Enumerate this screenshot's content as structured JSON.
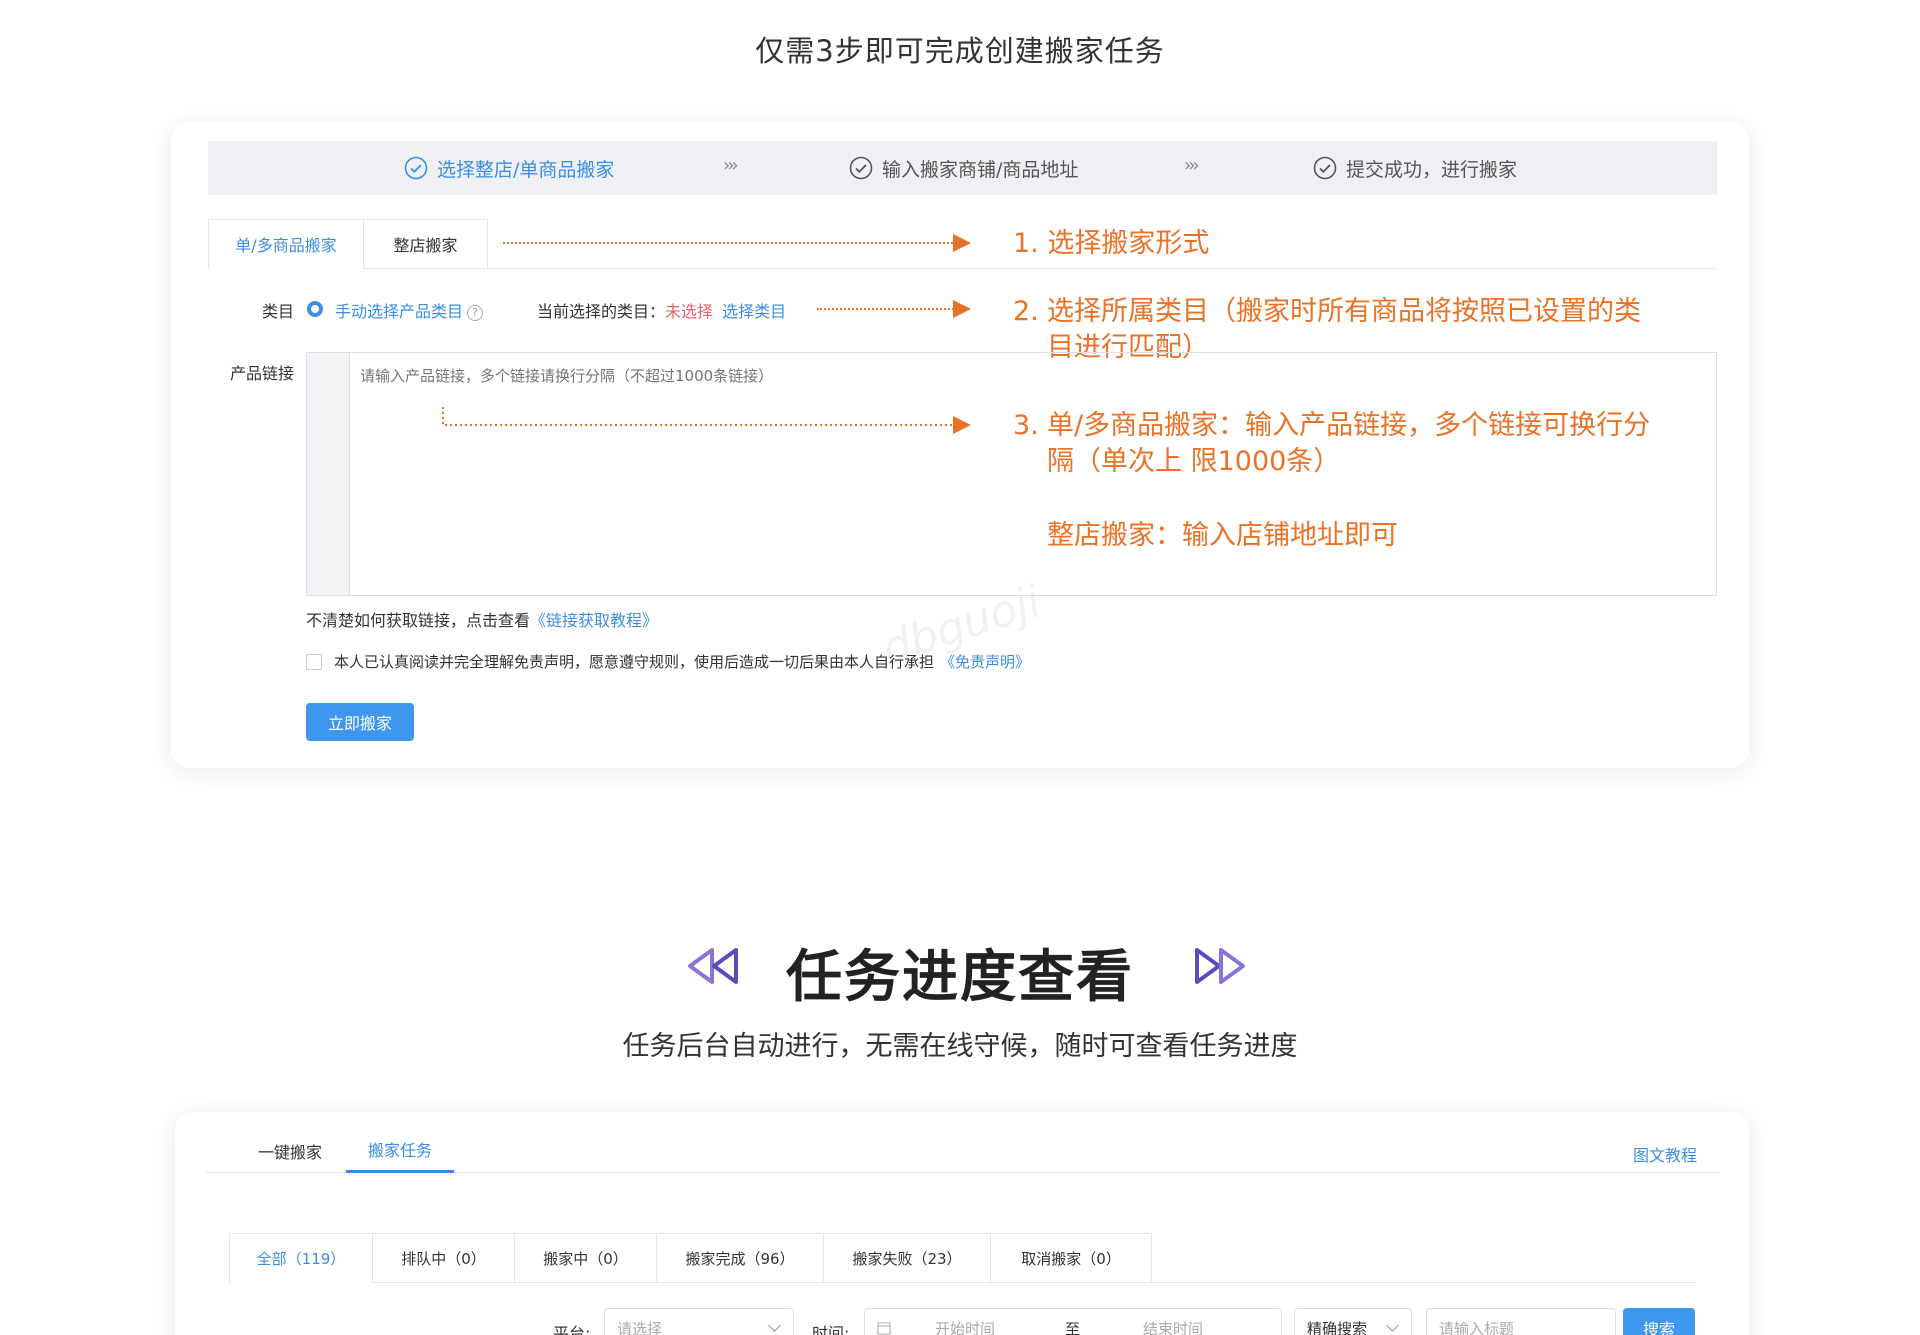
{
  "top_heading": "仅需3步即可完成创建搬家任务",
  "steps": [
    {
      "label": "选择整店/单商品搬家",
      "active": true
    },
    {
      "label": "输入搬家商铺/商品地址",
      "active": false
    },
    {
      "label": "提交成功，进行搬家",
      "active": false
    }
  ],
  "step_arrow": "›››",
  "tabs": [
    "单/多商品搬家",
    "整店搬家"
  ],
  "annotations": {
    "a1": "1.  选择搬家形式",
    "a2_num": "2.",
    "a2_text": "选择所属类目（搬家时所有商品将按照已设置的类目进行匹配）",
    "a3_num": "3.",
    "a3_line1": "单/多商品搬家：输入产品链接，多个链接可换行分隔（单次上    限1000条）",
    "a3_line2": "整店搬家：输入店铺地址即可"
  },
  "category": {
    "label": "类目",
    "option": "手动选择产品类目",
    "help": "?",
    "current_label": "当前选择的类目：",
    "current_value": "未选择",
    "select_link": "选择类目"
  },
  "product_links": {
    "label": "产品链接",
    "placeholder": "请输入产品链接，多个链接请换行分隔（不超过1000条链接）"
  },
  "hint": {
    "text": "不清楚如何获取链接，点击查看",
    "link": "《链接获取教程》"
  },
  "agreement": {
    "text": "本人已认真阅读并完全理解免责声明，愿意遵守规则，使用后造成一切后果由本人自行承担",
    "link": "《免责声明》"
  },
  "submit_button": "立即搬家",
  "watermark": "dbguoji",
  "section": {
    "title": "任务进度查看",
    "subtitle": "任务后台自动进行，无需在线守候，随时可查看任务进度"
  },
  "task_panel": {
    "tabs": [
      "一键搬家",
      "搬家任务"
    ],
    "active_tab": 1,
    "guide_link": "图文教程",
    "status_tabs": [
      "全部（119）",
      "排队中（0）",
      "搬家中（0）",
      "搬家完成（96）",
      "搬家失败（23）",
      "取消搬家（0）"
    ],
    "filters": {
      "platform_label": "平台:",
      "platform_placeholder": "请选择",
      "time_label": "时间:",
      "start_placeholder": "开始时间",
      "to": "至",
      "end_placeholder": "结束时间",
      "search_mode": "精确搜索",
      "title_placeholder": "请输入标题",
      "search_button": "搜索"
    }
  },
  "colors": {
    "accent": "#3d8ee3",
    "annotation": "#ea7227",
    "warning_text": "#e5636d"
  }
}
